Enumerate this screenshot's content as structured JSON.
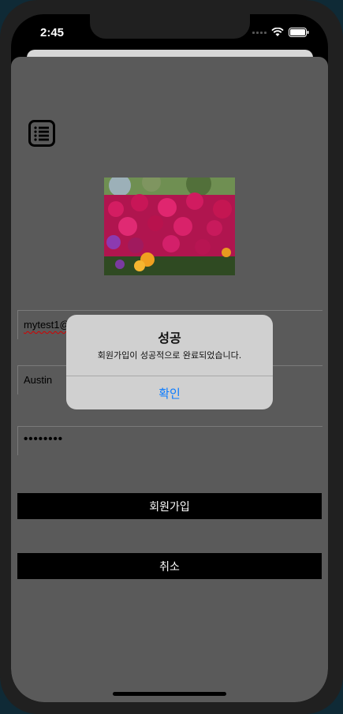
{
  "status_bar": {
    "time": "2:45"
  },
  "form": {
    "email_value": "mytest1@",
    "name_value": "Austin",
    "password_value": "••••••••"
  },
  "buttons": {
    "signup_label": "회원가입",
    "cancel_label": "취소"
  },
  "alert": {
    "title": "성공",
    "message": "회원가입이 성공적으로 완료되었습니다.",
    "confirm_label": "확인"
  },
  "colors": {
    "sheet_bg": "#5a5a5a",
    "alert_bg": "#d0d0d0",
    "accent_blue": "#0a7bff",
    "button_bg": "#000000"
  },
  "icons": [
    "list-menu-icon",
    "wifi-icon",
    "battery-icon",
    "cellular-signal-icon"
  ]
}
